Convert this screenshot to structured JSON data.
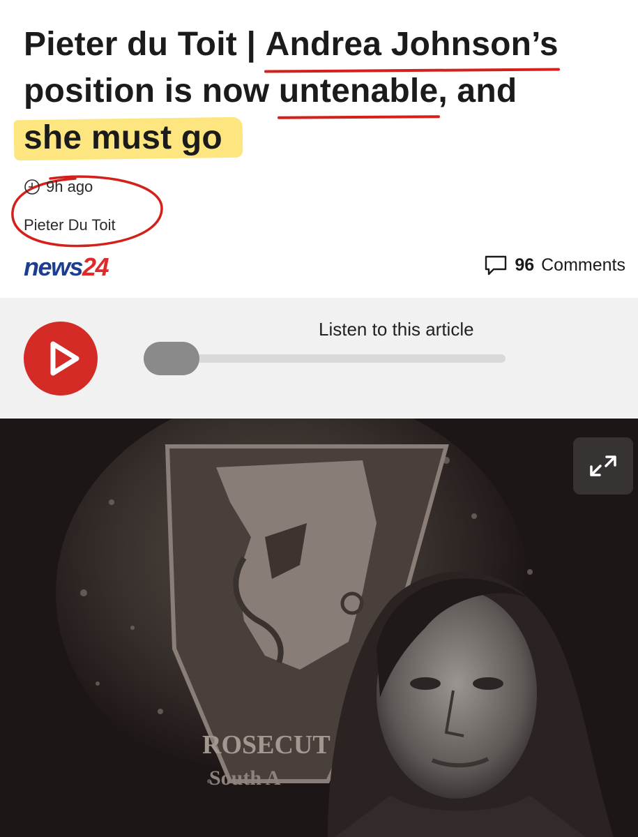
{
  "article": {
    "headline_lines": [
      [
        "Pieter du Toit | ",
        "Andrea Johnson’s"
      ],
      [
        "position is now ",
        "untenable",
        ", and"
      ],
      [
        "she must go"
      ]
    ],
    "time_ago": "9h ago",
    "author": "Pieter Du Toit"
  },
  "brand": {
    "news": "news",
    "num": "24"
  },
  "comments": {
    "count": "96",
    "label": "Comments"
  },
  "audio": {
    "label": "Listen to this article",
    "progress": 0.0
  },
  "hero": {
    "badge_line1": "ROSECUT",
    "badge_line2": "South A"
  },
  "icons": {
    "clock": "clock-icon",
    "comment": "comment-bubble-icon",
    "play": "play-icon",
    "expand": "expand-icon"
  },
  "colors": {
    "annotation_red": "#d3201a",
    "highlight_yellow": "#fde26a",
    "play_red": "#d42b26",
    "news_blue": "#1d3d8f",
    "news_red": "#e02a2a"
  }
}
